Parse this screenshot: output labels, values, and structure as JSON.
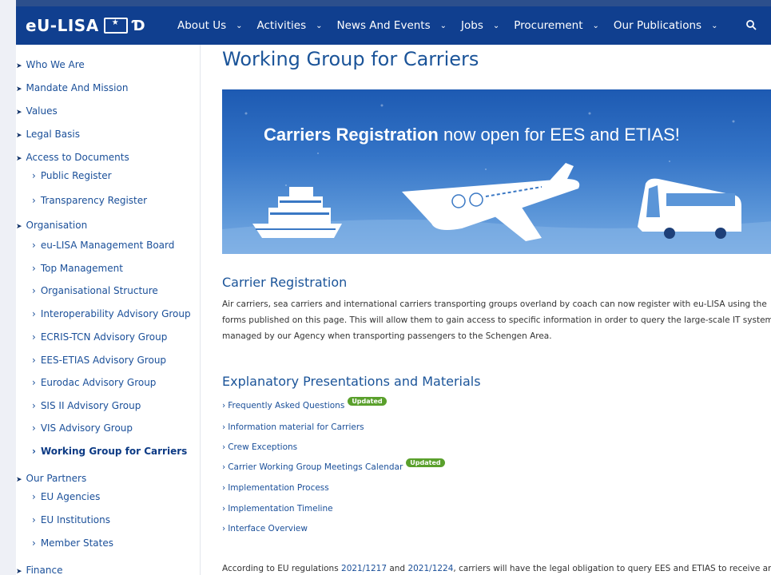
{
  "nav": {
    "logo_text": "eU-LISA",
    "items": [
      {
        "label": "About Us"
      },
      {
        "label": "Activities"
      },
      {
        "label": "News And Events"
      },
      {
        "label": "Jobs"
      },
      {
        "label": "Procurement"
      },
      {
        "label": "Our Publications"
      }
    ],
    "search_icon": "search-icon"
  },
  "sidebar": {
    "items": [
      {
        "label": "Who We Are",
        "level": "top"
      },
      {
        "label": "Mandate And Mission",
        "level": "top"
      },
      {
        "label": "Values",
        "level": "top"
      },
      {
        "label": "Legal Basis",
        "level": "top"
      },
      {
        "label": "Access to Documents",
        "level": "top"
      },
      {
        "label": "Public Register",
        "level": "sub"
      },
      {
        "label": "Transparency Register",
        "level": "sub"
      },
      {
        "label": "Organisation",
        "level": "top"
      },
      {
        "label": "eu-LISA Management Board",
        "level": "sub"
      },
      {
        "label": "Top Management",
        "level": "sub"
      },
      {
        "label": "Organisational Structure",
        "level": "sub"
      },
      {
        "label": "Interoperability Advisory Group",
        "level": "sub"
      },
      {
        "label": "ECRIS-TCN Advisory Group",
        "level": "sub"
      },
      {
        "label": "EES-ETIAS Advisory Group",
        "level": "sub"
      },
      {
        "label": "Eurodac Advisory Group",
        "level": "sub"
      },
      {
        "label": "SIS II Advisory Group",
        "level": "sub"
      },
      {
        "label": "VIS Advisory Group",
        "level": "sub"
      },
      {
        "label": "Working Group for Carriers",
        "level": "sub",
        "active": true
      },
      {
        "label": "Our Partners",
        "level": "top"
      },
      {
        "label": "EU Agencies",
        "level": "sub"
      },
      {
        "label": "EU Institutions",
        "level": "sub"
      },
      {
        "label": "Member States",
        "level": "sub"
      },
      {
        "label": "Finance",
        "level": "top"
      }
    ]
  },
  "main": {
    "title": "Working Group for Carriers",
    "banner": {
      "bold": "Carriers Registration",
      "rest": " now open for EES and ETIAS!"
    },
    "registration": {
      "heading": "Carrier Registration",
      "text": "Air carriers, sea carriers and international carriers transporting groups overland by coach can now register with eu-LISA using the forms published on this page. This will allow them to gain access to specific information in order to query the large-scale IT systems managed by our Agency when transporting passengers to the Schengen Area."
    },
    "materials": {
      "heading": "Explanatory Presentations and Materials",
      "links": [
        {
          "label": "Frequently Asked Questions",
          "badge": "Updated"
        },
        {
          "label": "Information material for Carriers",
          "badge": ""
        },
        {
          "label": "Crew Exceptions",
          "badge": ""
        },
        {
          "label": "Carrier Working Group Meetings Calendar",
          "badge": "Updated"
        },
        {
          "label": "Implementation Process",
          "badge": ""
        },
        {
          "label": "Implementation Timeline",
          "badge": ""
        },
        {
          "label": "Interface Overview",
          "badge": ""
        }
      ]
    },
    "legal": {
      "prefix": "According to EU regulations ",
      "reg1": "2021/1217",
      "and": " and ",
      "reg2": "2021/1224",
      "suffix": ", carriers will have the legal obligation to query EES and ETIAS to receive answers"
    }
  },
  "colors": {
    "nav_bg": "#103f8f",
    "link": "#1a4f99",
    "badge": "#5aa02c"
  }
}
